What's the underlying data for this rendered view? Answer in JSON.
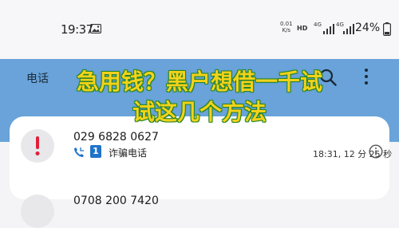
{
  "status_bar": {
    "time": "19:37",
    "net_speed_value": "0.01",
    "net_speed_unit": "K/s",
    "hd": "HD",
    "net_type_1": "4G",
    "net_type_2": "4G",
    "battery_percent": "24%"
  },
  "header": {
    "title": "电话"
  },
  "overlay": {
    "line1": "急用钱？黑户想借一千试",
    "line2": "试这几个方法",
    "color": "#f3d21a"
  },
  "call_log": [
    {
      "number": "029 6828 0627",
      "sim": "1",
      "label": "诈骗电话",
      "time": "18:31, 12 分 25 秒"
    },
    {
      "number": "0708 200 7420"
    }
  ],
  "colors": {
    "header_band": "#69a3d9",
    "sim_badge": "#1f73c9",
    "alert": "#e0203a"
  }
}
